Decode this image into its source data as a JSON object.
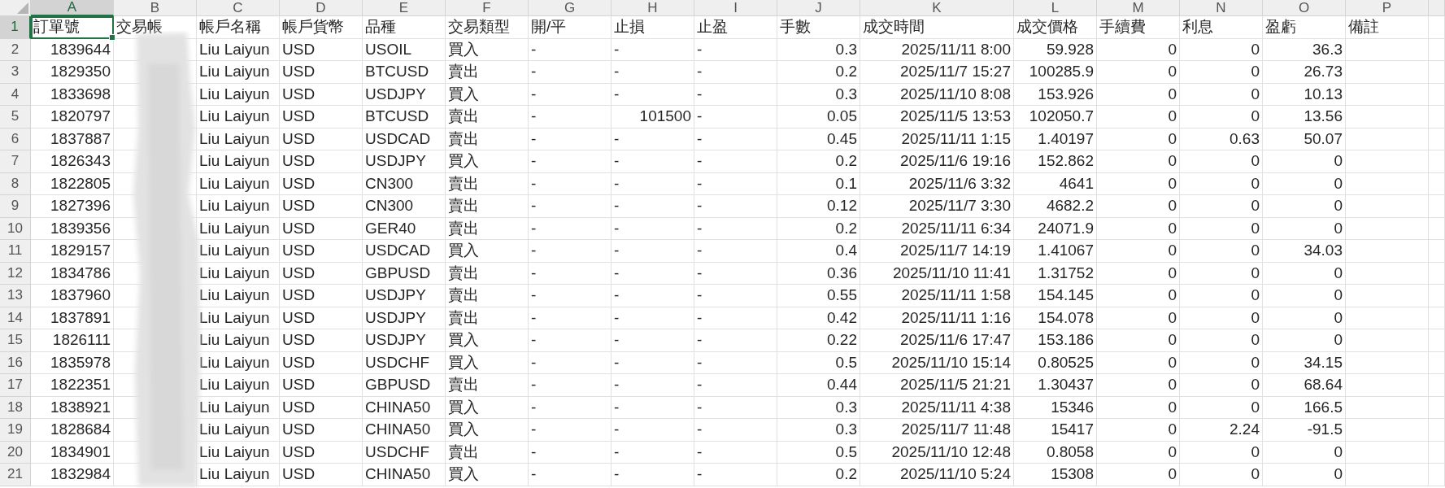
{
  "columns": [
    {
      "label": "A",
      "selected": true,
      "kind": "number"
    },
    {
      "label": "B",
      "selected": false,
      "kind": "text"
    },
    {
      "label": "C",
      "selected": false,
      "kind": "text"
    },
    {
      "label": "D",
      "selected": false,
      "kind": "text"
    },
    {
      "label": "E",
      "selected": false,
      "kind": "text"
    },
    {
      "label": "F",
      "selected": false,
      "kind": "text"
    },
    {
      "label": "G",
      "selected": false,
      "kind": "text"
    },
    {
      "label": "H",
      "selected": false,
      "kind": "text"
    },
    {
      "label": "I",
      "selected": false,
      "kind": "text"
    },
    {
      "label": "J",
      "selected": false,
      "kind": "number"
    },
    {
      "label": "K",
      "selected": false,
      "kind": "number"
    },
    {
      "label": "L",
      "selected": false,
      "kind": "number"
    },
    {
      "label": "M",
      "selected": false,
      "kind": "number"
    },
    {
      "label": "N",
      "selected": false,
      "kind": "number"
    },
    {
      "label": "O",
      "selected": false,
      "kind": "number"
    },
    {
      "label": "P",
      "selected": false,
      "kind": "text"
    }
  ],
  "header_row": {
    "number": "1",
    "selected": true,
    "cells": [
      "訂單號",
      "交易帳",
      "帳戶名稱",
      "帳戶貨幣",
      "品種",
      "交易類型",
      "開/平",
      "止損",
      "止盈",
      "手數",
      "成交時間",
      "成交價格",
      "手續費",
      "利息",
      "盈虧",
      "備註"
    ]
  },
  "rows": [
    {
      "number": "2",
      "selected": false,
      "cells": [
        "1839644",
        null,
        "Liu Laiyun",
        "USD",
        "USOIL",
        "買入",
        "-",
        "-",
        "-",
        "0.3",
        "2025/11/11 8:00",
        "59.928",
        "0",
        "0",
        "36.3"
      ]
    },
    {
      "number": "3",
      "selected": false,
      "cells": [
        "1829350",
        null,
        "Liu Laiyun",
        "USD",
        "BTCUSD",
        "賣出",
        "-",
        "-",
        "-",
        "0.2",
        "2025/11/7 15:27",
        "100285.9",
        "0",
        "0",
        "26.73"
      ]
    },
    {
      "number": "4",
      "selected": false,
      "cells": [
        "1833698",
        null,
        "Liu Laiyun",
        "USD",
        "USDJPY",
        "買入",
        "-",
        "-",
        "-",
        "0.3",
        "2025/11/10 8:08",
        "153.926",
        "0",
        "0",
        "10.13"
      ]
    },
    {
      "number": "5",
      "selected": false,
      "cells": [
        "1820797",
        null,
        "Liu Laiyun",
        "USD",
        "BTCUSD",
        "賣出",
        "-",
        {
          "text": "101500",
          "kind": "number"
        },
        "-",
        "0.05",
        "2025/11/5 13:53",
        "102050.7",
        "0",
        "0",
        "13.56"
      ]
    },
    {
      "number": "6",
      "selected": false,
      "cells": [
        "1837887",
        null,
        "Liu Laiyun",
        "USD",
        "USDCAD",
        "賣出",
        "-",
        "-",
        "-",
        "0.45",
        "2025/11/11 1:15",
        "1.40197",
        "0",
        "0.63",
        "50.07"
      ]
    },
    {
      "number": "7",
      "selected": false,
      "cells": [
        "1826343",
        null,
        "Liu Laiyun",
        "USD",
        "USDJPY",
        "買入",
        "-",
        "-",
        "-",
        "0.2",
        "2025/11/6 19:16",
        "152.862",
        "0",
        "0",
        "0"
      ]
    },
    {
      "number": "8",
      "selected": false,
      "cells": [
        "1822805",
        null,
        "Liu Laiyun",
        "USD",
        "CN300",
        "賣出",
        "-",
        "-",
        "-",
        "0.1",
        "2025/11/6 3:32",
        "4641",
        "0",
        "0",
        "0"
      ]
    },
    {
      "number": "9",
      "selected": false,
      "cells": [
        "1827396",
        null,
        "Liu Laiyun",
        "USD",
        "CN300",
        "賣出",
        "-",
        "-",
        "-",
        "0.12",
        "2025/11/7 3:30",
        "4682.2",
        "0",
        "0",
        "0"
      ]
    },
    {
      "number": "10",
      "selected": false,
      "cells": [
        "1839356",
        null,
        "Liu Laiyun",
        "USD",
        "GER40",
        "賣出",
        "-",
        "-",
        "-",
        "0.2",
        "2025/11/11 6:34",
        "24071.9",
        "0",
        "0",
        "0"
      ]
    },
    {
      "number": "11",
      "selected": false,
      "cells": [
        "1829157",
        null,
        "Liu Laiyun",
        "USD",
        "USDCAD",
        "買入",
        "-",
        "-",
        "-",
        "0.4",
        "2025/11/7 14:19",
        "1.41067",
        "0",
        "0",
        "34.03"
      ]
    },
    {
      "number": "12",
      "selected": false,
      "cells": [
        "1834786",
        null,
        "Liu Laiyun",
        "USD",
        "GBPUSD",
        "賣出",
        "-",
        "-",
        "-",
        "0.36",
        "2025/11/10 11:41",
        "1.31752",
        "0",
        "0",
        "0"
      ]
    },
    {
      "number": "13",
      "selected": false,
      "cells": [
        "1837960",
        null,
        "Liu Laiyun",
        "USD",
        "USDJPY",
        "賣出",
        "-",
        "-",
        "-",
        "0.55",
        "2025/11/11 1:58",
        "154.145",
        "0",
        "0",
        "0"
      ]
    },
    {
      "number": "14",
      "selected": false,
      "cells": [
        "1837891",
        null,
        "Liu Laiyun",
        "USD",
        "USDJPY",
        "賣出",
        "-",
        "-",
        "-",
        "0.42",
        "2025/11/11 1:16",
        "154.078",
        "0",
        "0",
        "0"
      ]
    },
    {
      "number": "15",
      "selected": false,
      "cells": [
        "1826111",
        null,
        "Liu Laiyun",
        "USD",
        "USDJPY",
        "買入",
        "-",
        "-",
        "-",
        "0.22",
        "2025/11/6 17:47",
        "153.186",
        "0",
        "0",
        "0"
      ]
    },
    {
      "number": "16",
      "selected": false,
      "cells": [
        "1835978",
        null,
        "Liu Laiyun",
        "USD",
        "USDCHF",
        "買入",
        "-",
        "-",
        "-",
        "0.5",
        "2025/11/10 15:14",
        "0.80525",
        "0",
        "0",
        "34.15"
      ]
    },
    {
      "number": "17",
      "selected": false,
      "cells": [
        "1822351",
        null,
        "Liu Laiyun",
        "USD",
        "GBPUSD",
        "賣出",
        "-",
        "-",
        "-",
        "0.44",
        "2025/11/5 21:21",
        "1.30437",
        "0",
        "0",
        "68.64"
      ]
    },
    {
      "number": "18",
      "selected": false,
      "cells": [
        "1838921",
        null,
        "Liu Laiyun",
        "USD",
        "CHINA50",
        "買入",
        "-",
        "-",
        "-",
        "0.3",
        "2025/11/11 4:38",
        "15346",
        "0",
        "0",
        "166.5"
      ]
    },
    {
      "number": "19",
      "selected": false,
      "cells": [
        "1828684",
        null,
        "Liu Laiyun",
        "USD",
        "CHINA50",
        "買入",
        "-",
        "-",
        "-",
        "0.3",
        "2025/11/7 11:48",
        "15417",
        "0",
        "2.24",
        "-91.5"
      ]
    },
    {
      "number": "20",
      "selected": false,
      "cells": [
        "1834901",
        null,
        "Liu Laiyun",
        "USD",
        "USDCHF",
        "賣出",
        "-",
        "-",
        "-",
        "0.5",
        "2025/11/10 12:48",
        "0.8058",
        "0",
        "0",
        "0"
      ]
    },
    {
      "number": "21",
      "selected": false,
      "cells": [
        "1832984",
        null,
        "Liu Laiyun",
        "USD",
        "CHINA50",
        "買入",
        "-",
        "-",
        "-",
        "0.2",
        "2025/11/10 5:24",
        "15308",
        "0",
        "0",
        "0"
      ]
    }
  ]
}
